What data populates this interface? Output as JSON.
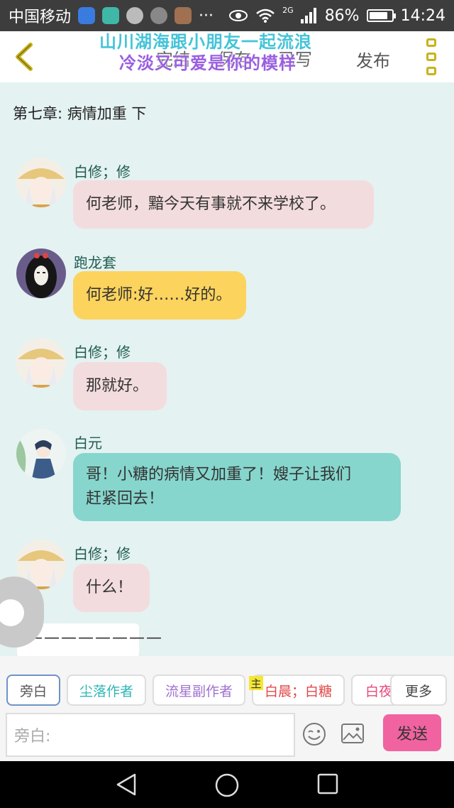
{
  "status_bar": {
    "carrier": "中国移动",
    "more": "···",
    "network": "2G",
    "battery_percent": "86%",
    "battery_level": 0.86,
    "time": "14:24"
  },
  "header": {
    "tabs": [
      "完结",
      "保存",
      "已写"
    ],
    "publish_label": "发布",
    "watermark_line1": "山川湖海跟小朋友一起流浪",
    "watermark_line2": "冷淡又可爱是你的模样"
  },
  "chat": {
    "chapter_title": "第七章: 病情加重  下",
    "messages": [
      {
        "sender": "白修；修",
        "text": "何老师，黯今天有事就不来学校了。",
        "style": "pink"
      },
      {
        "sender": "跑龙套",
        "text": "何老师:好……好的。",
        "style": "yellow"
      },
      {
        "sender": "白修；修",
        "text": "那就好。",
        "style": "pink"
      },
      {
        "sender": "白元",
        "text_line1": "哥！小糖的病情又加重了！嫂子让我们",
        "text_line2": "赶紧回去！",
        "style": "teal"
      },
      {
        "sender": "白修；修",
        "text": "什么！",
        "style": "pink"
      }
    ],
    "draft_card": "————————"
  },
  "roles": {
    "items": [
      {
        "label": "旁白",
        "color": "#555555"
      },
      {
        "label": "尘落作者",
        "color": "#2fb5b5"
      },
      {
        "label": "流星副作者",
        "color": "#a070d0"
      },
      {
        "label": "白晨；白糖",
        "color": "#e04848"
      },
      {
        "label": "白夜",
        "color": "#e8477a"
      }
    ],
    "master_tag": "主",
    "more_label": "更多"
  },
  "input": {
    "placeholder": "旁白:",
    "send_label": "发送"
  },
  "colors": {
    "chat_bg": "#e4f2f1",
    "bubble_pink": "#f3dcdd",
    "bubble_yellow": "#fcd35c",
    "bubble_teal": "#86d6cd",
    "send": "#f163a0",
    "menu_accent": "#c9b21a"
  }
}
